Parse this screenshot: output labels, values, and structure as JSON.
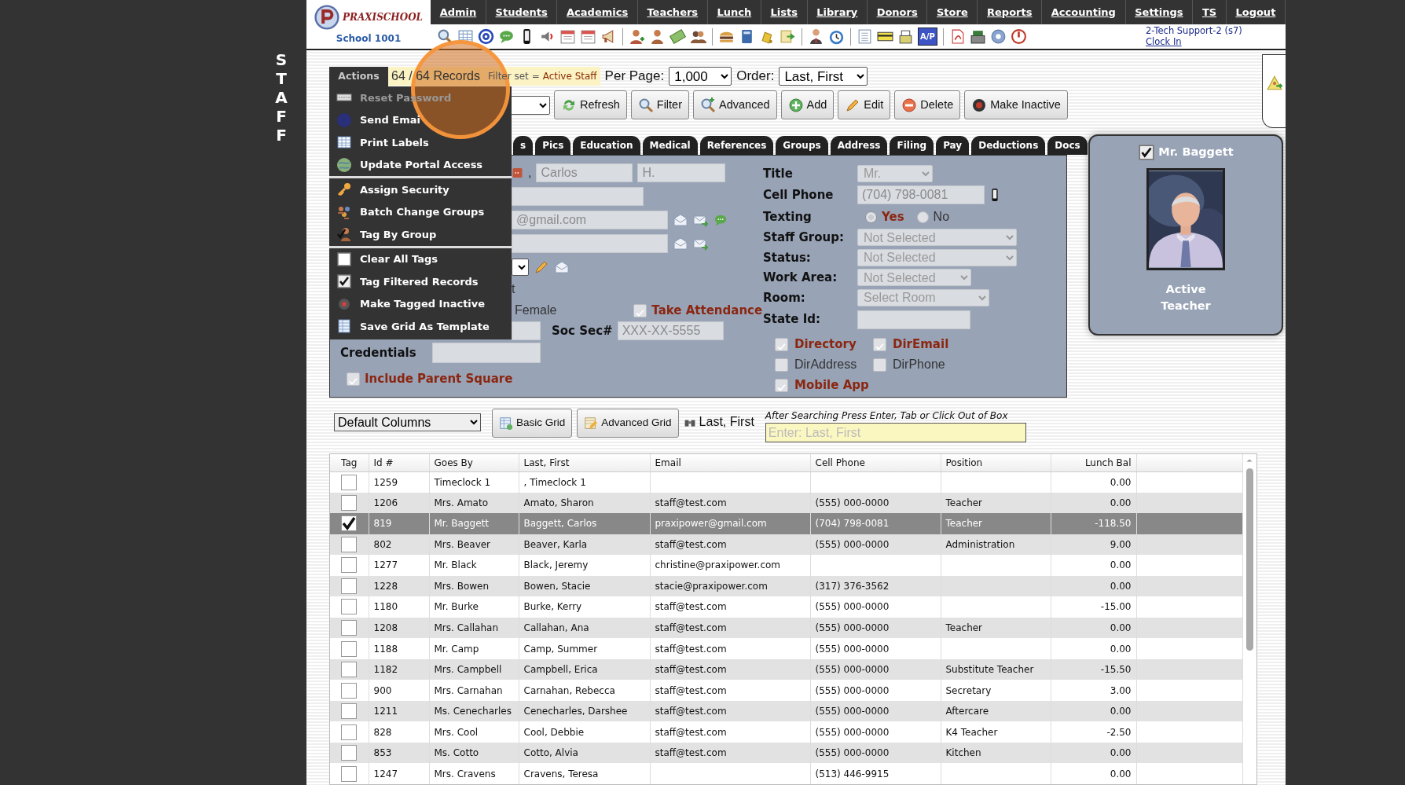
{
  "side_label": "STAFF",
  "logo": {
    "name": "PRAXISCHOOL",
    "school": "School 1001"
  },
  "nav": [
    "Admin",
    "Students",
    "Academics",
    "Teachers",
    "Lunch",
    "Lists",
    "Library",
    "Donors",
    "Store",
    "Reports",
    "Accounting",
    "Settings",
    "TS",
    "Logout"
  ],
  "toolbar": {
    "ap_label": "A/P"
  },
  "user": {
    "name": "2-Tech Support-2 (s7)",
    "clock_link": "Clock In"
  },
  "records": {
    "count": "64 / 64 Records",
    "filter_label": "Filter set =",
    "filter_value": "Active Staff"
  },
  "per_page": {
    "label": "Per Page:",
    "value": "1,000"
  },
  "order": {
    "label": "Order:",
    "value": "Last, First"
  },
  "buttons": [
    "Refresh",
    "Filter",
    "Advanced",
    "Add",
    "Edit",
    "Delete",
    "Make Inactive"
  ],
  "actions_menu": {
    "title": "Actions",
    "groups": [
      [
        {
          "label": "Reset Password",
          "disabled": true
        },
        {
          "label": "Send Emai",
          "disabled": false
        },
        {
          "label": "Print Labels",
          "disabled": false
        },
        {
          "label": "Update Portal Access",
          "disabled": false
        }
      ],
      [
        {
          "label": "Assign Security",
          "disabled": false
        },
        {
          "label": "Batch Change Groups",
          "disabled": false
        },
        {
          "label": "Tag By Group",
          "disabled": false
        }
      ],
      [
        {
          "label": "Clear All Tags",
          "disabled": false
        },
        {
          "label": "Tag Filtered Records",
          "disabled": false
        },
        {
          "label": "Make Tagged Inactive",
          "disabled": false
        },
        {
          "label": "Save Grid As Template",
          "disabled": false
        }
      ]
    ]
  },
  "tabs": [
    {
      "label": "s",
      "selected": false
    },
    {
      "label": "Pics",
      "selected": false
    },
    {
      "label": "Education",
      "selected": false
    },
    {
      "label": "Medical",
      "selected": false
    },
    {
      "label": "References",
      "selected": false
    },
    {
      "label": "Groups",
      "selected": false
    },
    {
      "label": "Address",
      "selected": false
    },
    {
      "label": "Filing",
      "selected": false
    },
    {
      "label": "Pay",
      "selected": false
    },
    {
      "label": "Deductions",
      "selected": false
    },
    {
      "label": "Docs",
      "selected": false
    }
  ],
  "form": {
    "name_separator": ",",
    "first_name": "Carlos",
    "middle_initial": "H.",
    "email": "@gmail.com",
    "fragment": "t",
    "gender": "Female",
    "take_attendance": {
      "label": "Take Attendance",
      "checked": true
    },
    "soc_sec": {
      "label": "Soc Sec#",
      "value": "XXX-XX-5555"
    },
    "credentials": {
      "label": "Credentials"
    },
    "include_parent_square": {
      "label": "Include Parent Square",
      "checked": true
    },
    "title": {
      "label": "Title",
      "value": "Mr."
    },
    "cell_phone": {
      "label": "Cell Phone",
      "value": "(704) 798-0081"
    },
    "texting": {
      "label": "Texting",
      "options": [
        {
          "label": "Yes",
          "selected": true
        },
        {
          "label": "No",
          "selected": false
        }
      ]
    },
    "selects": [
      {
        "label": "Staff Group:",
        "value": "Not Selected"
      },
      {
        "label": "Status:",
        "value": "Not Selected"
      },
      {
        "label": "Work Area:",
        "value": "Not Selected"
      },
      {
        "label": "Room:",
        "value": "Select Room"
      }
    ],
    "state_id": {
      "label": "State Id:"
    },
    "directory_flags": [
      {
        "label": "Directory",
        "checked": true
      },
      {
        "label": "DirEmail",
        "checked": true
      },
      {
        "label": "DirAddress",
        "checked": false
      },
      {
        "label": "DirPhone",
        "checked": false
      },
      {
        "label": "Mobile App",
        "checked": true
      }
    ]
  },
  "profile_card": {
    "tagged": true,
    "name": "Mr. Baggett",
    "status": "Active",
    "position": "Teacher"
  },
  "grid_controls": {
    "columns_select": "Default Columns",
    "buttons": [
      "Basic Grid",
      "Advanced Grid"
    ],
    "sort_label": "Last, First",
    "search_hint": "After Searching Press Enter, Tab or Click Out of Box",
    "search_placeholder": "Enter: Last, First"
  },
  "table": {
    "tag_column": "Tag",
    "columns": [
      "Id #",
      "Goes By",
      "Last, First",
      "Email",
      "Cell Phone",
      "Position",
      "Lunch Bal"
    ],
    "rows": [
      {
        "tagged": false,
        "selected": false,
        "cells": [
          "1259",
          "Timeclock 1",
          ", Timeclock 1",
          null,
          null,
          null,
          "0.00"
        ]
      },
      {
        "tagged": false,
        "selected": false,
        "cells": [
          "1206",
          "Mrs. Amato",
          "Amato, Sharon",
          "staff@test.com",
          "(555) 000-0000",
          "Teacher",
          "0.00"
        ]
      },
      {
        "tagged": true,
        "selected": true,
        "cells": [
          "819",
          "Mr. Baggett",
          "Baggett, Carlos",
          "praxipower@gmail.com",
          "(704) 798-0081",
          "Teacher",
          "-118.50"
        ]
      },
      {
        "tagged": false,
        "selected": false,
        "cells": [
          "802",
          "Mrs. Beaver",
          "Beaver, Karla",
          "staff@test.com",
          "(555) 000-0000",
          "Administration",
          "9.00"
        ]
      },
      {
        "tagged": false,
        "selected": false,
        "cells": [
          "1277",
          "Mr. Black",
          "Black, Jeremy",
          "christine@praxipower.com",
          null,
          null,
          "0.00"
        ]
      },
      {
        "tagged": false,
        "selected": false,
        "cells": [
          "1228",
          "Mrs. Bowen",
          "Bowen, Stacie",
          "stacie@praxipower.com",
          "(317) 376-3562",
          null,
          "0.00"
        ]
      },
      {
        "tagged": false,
        "selected": false,
        "cells": [
          "1180",
          "Mr. Burke",
          "Burke, Kerry",
          "staff@test.com",
          "(555) 000-0000",
          null,
          "-15.00"
        ]
      },
      {
        "tagged": false,
        "selected": false,
        "cells": [
          "1208",
          "Mrs. Callahan",
          "Callahan, Ana",
          "staff@test.com",
          "(555) 000-0000",
          "Teacher",
          "0.00"
        ]
      },
      {
        "tagged": false,
        "selected": false,
        "cells": [
          "1188",
          "Mr. Camp",
          "Camp, Summer",
          "staff@test.com",
          "(555) 000-0000",
          null,
          "0.00"
        ]
      },
      {
        "tagged": false,
        "selected": false,
        "cells": [
          "1182",
          "Mrs. Campbell",
          "Campbell, Erica",
          "staff@test.com",
          "(555) 000-0000",
          "Substitute Teacher",
          "-15.50"
        ]
      },
      {
        "tagged": false,
        "selected": false,
        "cells": [
          "900",
          "Mrs. Carnahan",
          "Carnahan, Rebecca",
          "staff@test.com",
          "(555) 000-0000",
          "Secretary",
          "3.00"
        ]
      },
      {
        "tagged": false,
        "selected": false,
        "cells": [
          "1211",
          "Ms. Cenecharles",
          "Cenecharles, Darshee",
          "staff@test.com",
          "(555) 000-0000",
          "Aftercare",
          "0.00"
        ]
      },
      {
        "tagged": false,
        "selected": false,
        "cells": [
          "828",
          "Mrs. Cool",
          "Cool, Debbie",
          "staff@test.com",
          "(555) 000-0000",
          "K4 Teacher",
          "-2.50"
        ]
      },
      {
        "tagged": false,
        "selected": false,
        "cells": [
          "853",
          "Ms. Cotto",
          "Cotto, Alvia",
          "staff@test.com",
          "(555) 000-0000",
          "Kitchen",
          "0.00"
        ]
      },
      {
        "tagged": false,
        "selected": false,
        "cells": [
          "1247",
          "Mrs. Cravens",
          "Cravens, Teresa",
          null,
          "(513) 446-9915",
          null,
          "0.00"
        ]
      }
    ]
  }
}
